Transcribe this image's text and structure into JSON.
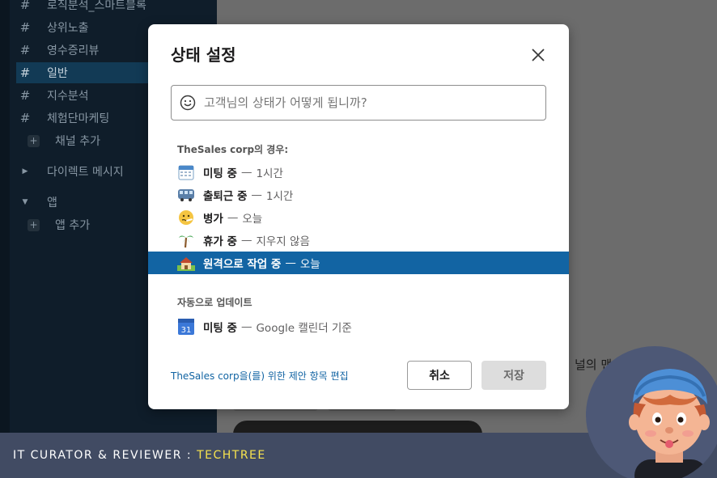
{
  "sidebar": {
    "channels": [
      {
        "label": "로직분석_스마트블록",
        "active": false
      },
      {
        "label": "상위노출",
        "active": false
      },
      {
        "label": "영수증리뷰",
        "active": false
      },
      {
        "label": "일반",
        "active": true
      },
      {
        "label": "지수분석",
        "active": false
      },
      {
        "label": "체험단마케팅",
        "active": false
      }
    ],
    "add_channel": "채널 추가",
    "direct_messages": "다이렉트 메시지",
    "apps": "앱",
    "add_app": "앱 추가"
  },
  "background": {
    "partial_text": "널의 맨"
  },
  "modal": {
    "title": "상태 설정",
    "input_placeholder": "고객님의 상태가 어떻게 됩니까?",
    "suggest_label": "TheSales corp의 경우:",
    "options": [
      {
        "emoji": "calendar-icon",
        "name": "미팅 중",
        "duration": "1시간",
        "selected": false
      },
      {
        "emoji": "bus-icon",
        "name": "출퇴근 중",
        "duration": "1시간",
        "selected": false
      },
      {
        "emoji": "sick-face-icon",
        "name": "병가",
        "duration": "오늘",
        "selected": false
      },
      {
        "emoji": "palm-tree-icon",
        "name": "휴가 중",
        "duration": "지우지 않음",
        "selected": false
      },
      {
        "emoji": "house-icon",
        "name": "원격으로 작업 중",
        "duration": "오늘",
        "selected": true
      }
    ],
    "auto_label": "자동으로 업데이트",
    "auto_option": {
      "emoji": "google-calendar-icon",
      "name": "미팅 중",
      "duration": "Google 캘린더 기준",
      "calendar_day": "31"
    },
    "edit_link": "TheSales corp을(를) 위한 제안 항목 편집",
    "cancel_label": "취소",
    "save_label": "저장",
    "separator": "—"
  },
  "banner": {
    "prefix": "IT CURATOR & REVIEWER : ",
    "highlight": "TECHTREE"
  },
  "colors": {
    "selected_row": "#1264a3",
    "banner_bg": "#414b63",
    "banner_highlight": "#f7e34e"
  }
}
